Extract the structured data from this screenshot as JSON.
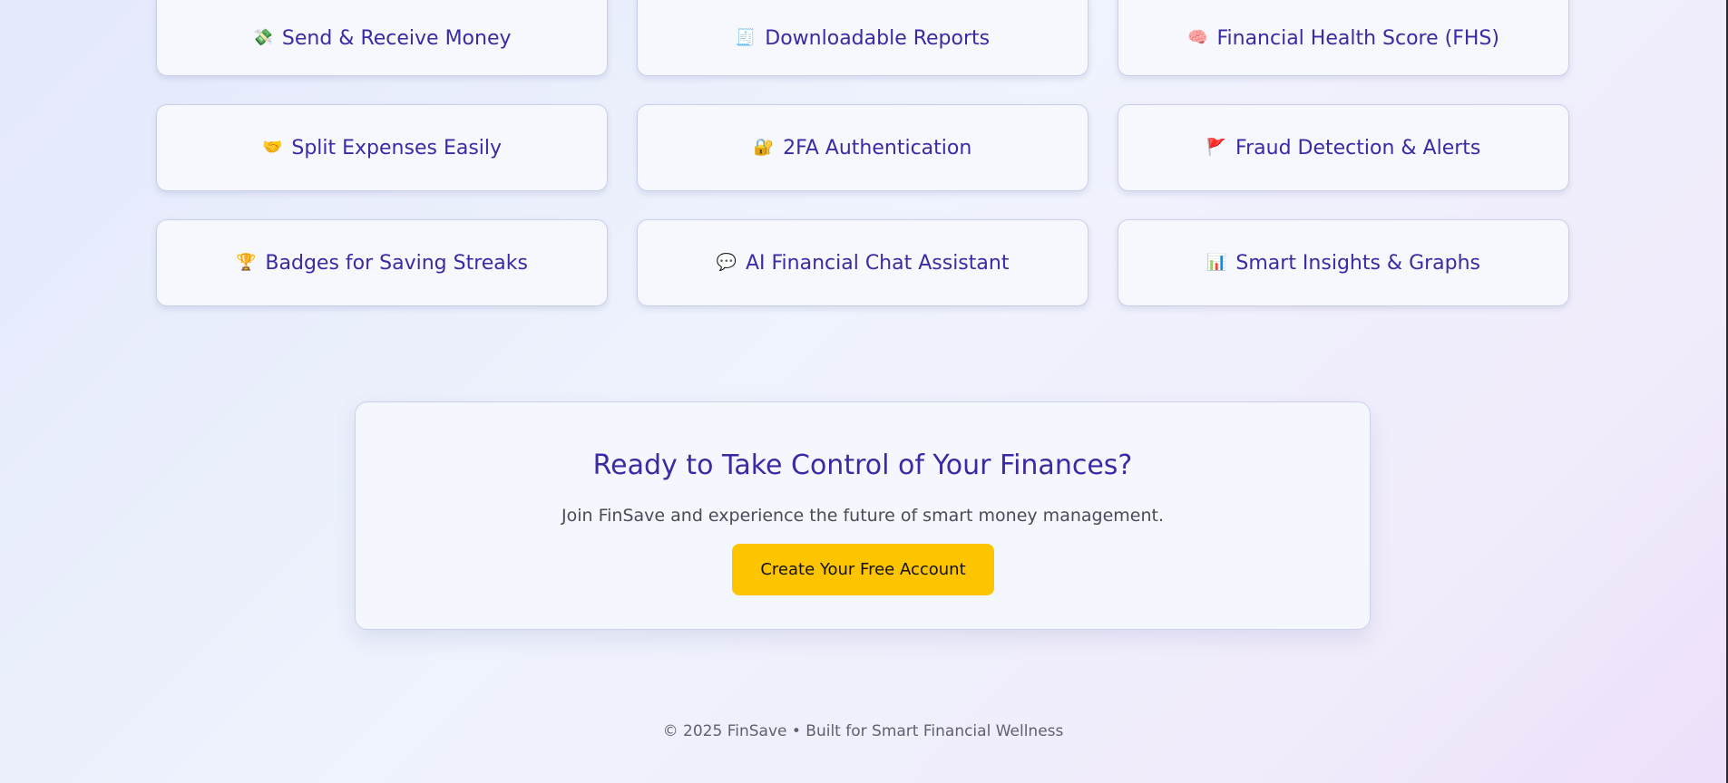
{
  "features": [
    {
      "icon": "💸",
      "icon_name": "money-wings-icon",
      "label": "Send & Receive Money"
    },
    {
      "icon": "🧾",
      "icon_name": "receipt-icon",
      "label": "Downloadable Reports"
    },
    {
      "icon": "🧠",
      "icon_name": "brain-icon",
      "label": "Financial Health Score (FHS)"
    },
    {
      "icon": "🤝",
      "icon_name": "handshake-icon",
      "label": "Split Expenses Easily"
    },
    {
      "icon": "🔐",
      "icon_name": "lock-key-icon",
      "label": "2FA Authentication"
    },
    {
      "icon": "🚩",
      "icon_name": "red-flag-icon",
      "label": "Fraud Detection & Alerts"
    },
    {
      "icon": "🏆",
      "icon_name": "trophy-icon",
      "label": "Badges for Saving Streaks"
    },
    {
      "icon": "💬",
      "icon_name": "speech-bubble-icon",
      "label": "AI Financial Chat Assistant"
    },
    {
      "icon": "📊",
      "icon_name": "bar-chart-icon",
      "label": "Smart Insights & Graphs"
    }
  ],
  "cta": {
    "title": "Ready to Take Control of Your Finances?",
    "subtitle": "Join FinSave and experience the future of smart money management.",
    "button_label": "Create Your Free Account"
  },
  "footer": {
    "text": "© 2025 FinSave • Built for Smart Financial Wellness"
  },
  "colors": {
    "accent_text": "#3a2aa3",
    "cta_button": "#fcc500"
  }
}
